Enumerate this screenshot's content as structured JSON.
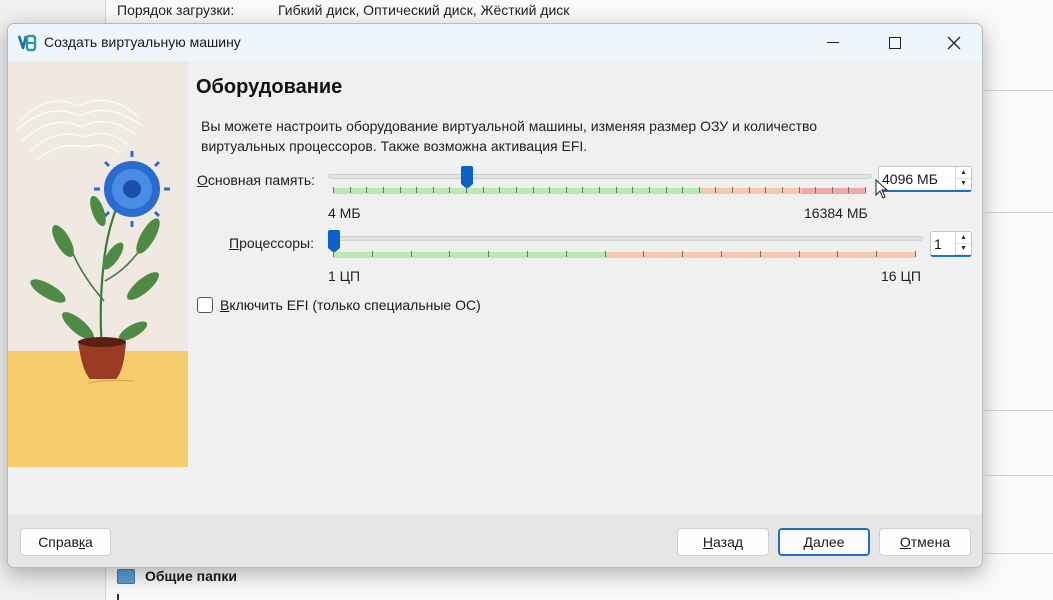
{
  "background": {
    "boot_order_label": "Порядок загрузки:",
    "boot_order_value": "Гибкий диск, Оптический диск, Жёсткий диск",
    "shared_folders": "Общие папки"
  },
  "dialog": {
    "title": "Создать виртуальную машину",
    "heading": "Оборудование",
    "description": "Вы можете настроить оборудование виртуальной машины, изменяя размер ОЗУ и количество виртуальных процессоров. Также возможна активация EFI.",
    "memory": {
      "label_prefix": "",
      "label_underlined": "О",
      "label_rest": "сновная память:",
      "value": "4096 МБ",
      "min_label": "4 МБ",
      "max_label": "16384 МБ",
      "current_mb": 4096,
      "max_mb": 16384
    },
    "cpu": {
      "label_underlined": "П",
      "label_rest": "роцессоры:",
      "value": "1",
      "min_label": "1 ЦП",
      "max_label": "16 ЦП",
      "current": 1,
      "max": 16
    },
    "efi": {
      "label_underlined": "В",
      "label_rest": "ключить EFI (только специальные ОС)",
      "checked": false
    },
    "buttons": {
      "help_main": "Справ",
      "help_underlined": "к",
      "help_end": "а",
      "back_underlined": "Н",
      "back_rest": "азад",
      "next_underlined": "Д",
      "next_rest": "алее",
      "cancel_underlined": "О",
      "cancel_rest": "тмена"
    }
  },
  "colors": {
    "accent": "#0a62c8",
    "scale_green": "#b9e9b0",
    "scale_orange": "#f5c7b2",
    "scale_red": "#f1a8a8",
    "art_floor": "#f6cd6a"
  }
}
